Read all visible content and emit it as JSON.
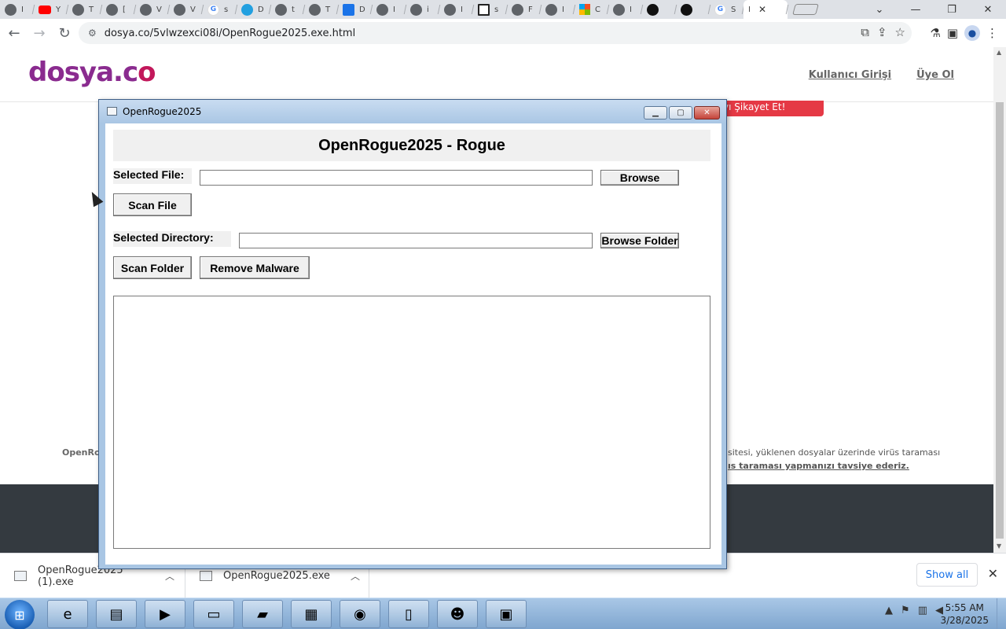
{
  "browser": {
    "tabs": [
      {
        "icon": "chrome-icon",
        "letter": "I"
      },
      {
        "icon": "youtube-icon",
        "letter": "Y"
      },
      {
        "icon": "globe-icon",
        "letter": "T"
      },
      {
        "icon": "globe-icon",
        "letter": "["
      },
      {
        "icon": "gauge-icon",
        "letter": "V"
      },
      {
        "icon": "java-icon",
        "letter": "V"
      },
      {
        "icon": "google-icon",
        "letter": "s"
      },
      {
        "icon": "shield-icon",
        "letter": "D"
      },
      {
        "icon": "globe-icon",
        "letter": "t"
      },
      {
        "icon": "globe-icon",
        "letter": "T"
      },
      {
        "icon": "download-icon",
        "letter": "D"
      },
      {
        "icon": "globe-icon",
        "letter": "I"
      },
      {
        "icon": "globe-icon",
        "letter": "i"
      },
      {
        "icon": "malware-icon",
        "letter": "I"
      },
      {
        "icon": "document-icon",
        "letter": "s"
      },
      {
        "icon": "user-icon",
        "letter": "F"
      },
      {
        "icon": "globe-icon",
        "letter": "I"
      },
      {
        "icon": "microsoft-icon",
        "letter": "C"
      },
      {
        "icon": "globe-icon",
        "letter": "I"
      },
      {
        "icon": "github-icon",
        "letter": ""
      },
      {
        "icon": "github-icon",
        "letter": ""
      },
      {
        "icon": "google-icon",
        "letter": "S"
      }
    ],
    "active_tab": {
      "letter": "I",
      "close": "✕"
    },
    "url": "dosya.co/5vlwzexci08i/OpenRogue2025.exe.html"
  },
  "site": {
    "logo_main": "dosya.c",
    "logo_accent": "o",
    "login_link": "Kullanıcı Girişi",
    "register_link": "Üye Ol",
    "report_button": "yı Şikayet Et!",
    "text_left": "OpenRo",
    "text_right_1": "sitesi, yüklenen dosyalar üzerinde virüs taraması",
    "text_right_2": "ıs taraması yapmanızı tavsiye ederiz."
  },
  "downloads": {
    "items": [
      {
        "name": "OpenRogue2025 (1).exe"
      },
      {
        "name": "OpenRogue2025.exe"
      }
    ],
    "show_all": "Show all"
  },
  "app_window": {
    "title": "OpenRogue2025",
    "heading": "OpenRogue2025 - Rogue",
    "selected_file_label": "Selected File:",
    "selected_file_value": "",
    "browse_button": "Browse",
    "scan_file_button": "Scan File",
    "selected_directory_label": "Selected Directory:",
    "selected_directory_value": "",
    "browse_folder_button": "Browse Folder",
    "scan_folder_button": "Scan Folder",
    "remove_malware_button": "Remove Malware",
    "output_text": ""
  },
  "taskbar": {
    "time": "5:55 AM",
    "date": "3/28/2025"
  },
  "colors": {
    "logo_purple": "#8a2b8f",
    "report_red": "#e53945",
    "footer_dark": "#343a40",
    "window_frame": "#a9c6e4"
  }
}
